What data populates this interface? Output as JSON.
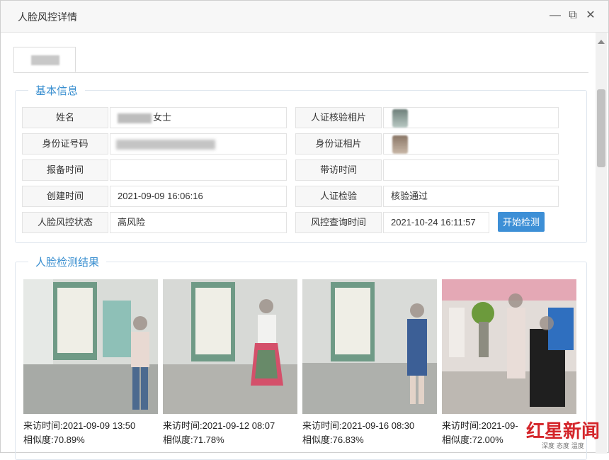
{
  "window": {
    "title": "人脸风控详情",
    "controls": {
      "minimize": "—",
      "restore": "⧉",
      "close": "✕"
    }
  },
  "basic_info": {
    "legend": "基本信息",
    "fields": {
      "name_label": "姓名",
      "name_value_suffix": "女士",
      "id_number_label": "身份证号码",
      "report_time_label": "报备时间",
      "report_time_value": "",
      "created_time_label": "创建时间",
      "created_time_value": "2021-09-09 16:06:16",
      "risk_status_label": "人脸风控状态",
      "risk_status_value": "高风险",
      "id_verify_photo_label": "人证核验相片",
      "id_photo_label": "身份证相片",
      "visit_time_label": "带访时间",
      "visit_time_value": "",
      "id_check_label": "人证检验",
      "id_check_value": "核验通过",
      "risk_query_time_label": "风控查询时间",
      "risk_query_time_value": "2021-10-24 16:11:57",
      "start_detect_button": "开始检测"
    }
  },
  "detection_results": {
    "legend": "人脸检测结果",
    "items": [
      {
        "visit": "来访时间:2021-09-09 13:50",
        "similarity": "相似度:70.89%"
      },
      {
        "visit": "来访时间:2021-09-12 08:07",
        "similarity": "相似度:71.78%"
      },
      {
        "visit": "来访时间:2021-09-16 08:30",
        "similarity": "相似度:76.83%"
      },
      {
        "visit": "来访时间:2021-09-",
        "similarity": "相似度:72.00%"
      }
    ]
  },
  "watermark": {
    "brand": "红星新闻",
    "slogan": "深度 态度 温度"
  },
  "colors": {
    "accent": "#3a8fd0",
    "button": "#3d8fd6",
    "brand_red": "#d4252a"
  }
}
